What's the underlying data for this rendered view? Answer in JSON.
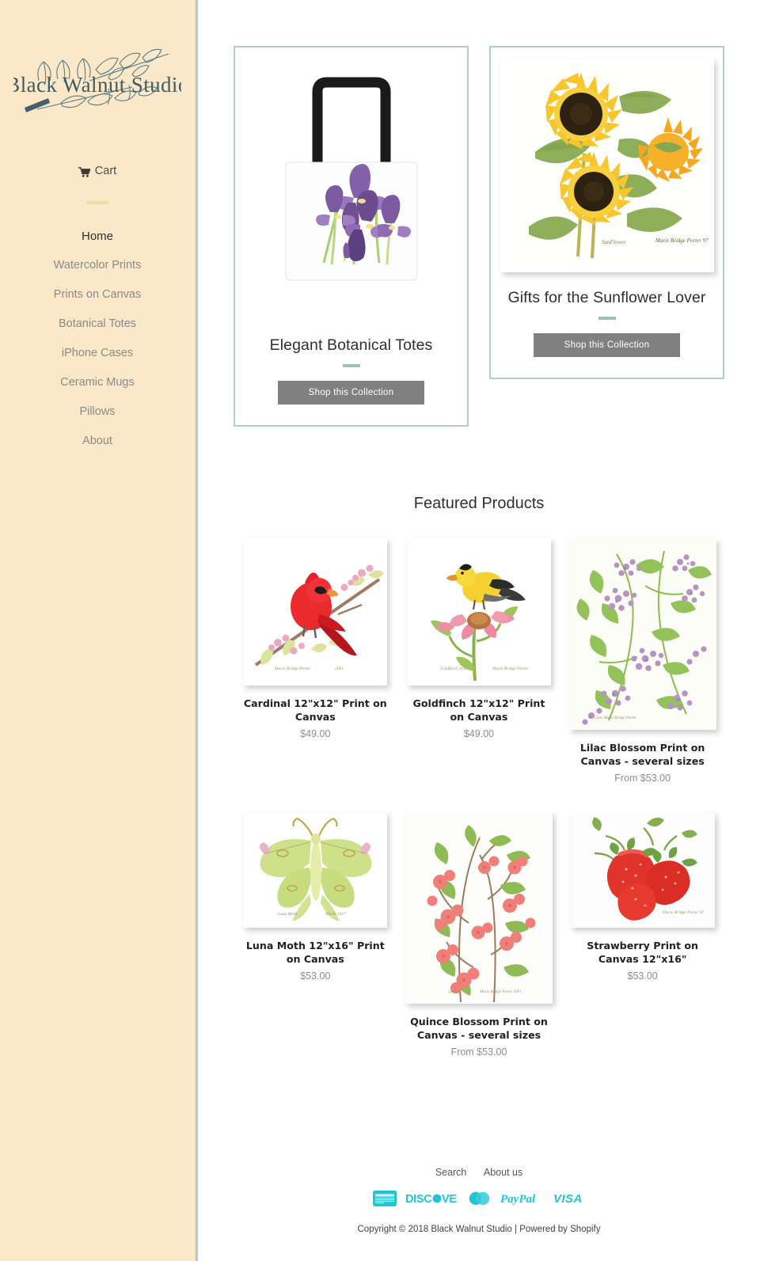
{
  "brand": {
    "name": "Black Walnut Studio"
  },
  "sidebar": {
    "cart_label": "Cart",
    "nav": [
      {
        "label": "Home",
        "active": true
      },
      {
        "label": "Watercolor Prints",
        "active": false
      },
      {
        "label": "Prints on Canvas",
        "active": false
      },
      {
        "label": "Botanical Totes",
        "active": false
      },
      {
        "label": "iPhone Cases",
        "active": false
      },
      {
        "label": "Ceramic Mugs",
        "active": false
      },
      {
        "label": "Pillows",
        "active": false
      },
      {
        "label": "About",
        "active": false
      }
    ]
  },
  "hero": {
    "left": {
      "title": "Elegant Botanical Totes",
      "button": "Shop this Collection"
    },
    "right": {
      "title": "Gifts for the Sunflower Lover",
      "button": "Shop this Collection"
    }
  },
  "featured": {
    "heading": "Featured Products",
    "products": [
      {
        "title": "Cardinal 12\"x12\" Print on Canvas",
        "price": "$49.00"
      },
      {
        "title": "Goldfinch 12\"x12\" Print on Canvas",
        "price": "$49.00"
      },
      {
        "title": "Lilac Blossom Print on Canvas - several sizes",
        "price": "From $53.00"
      },
      {
        "title": "Luna Moth 12\"x16\" Print on Canvas",
        "price": "$53.00"
      },
      {
        "title": "Quince Blossom Print on Canvas - several sizes",
        "price": "From $53.00"
      },
      {
        "title": "Strawberry Print on Canvas 12\"x16\"",
        "price": "$53.00"
      }
    ]
  },
  "footer": {
    "links": [
      "Search",
      "About us"
    ],
    "payments": [
      "amex-icon",
      "discover-icon",
      "mastercard-icon",
      "paypal-icon",
      "visa-icon"
    ],
    "copyright": "Copyright © 2018 Black Walnut Studio | Powered by Shopify"
  },
  "colors": {
    "sidebar_bg": "#fbe8c8",
    "sage_border": "#b3ccc4",
    "button_gray": "#808080",
    "payment_teal": "#21c5d4",
    "logo_ink": "#3f5d66"
  }
}
